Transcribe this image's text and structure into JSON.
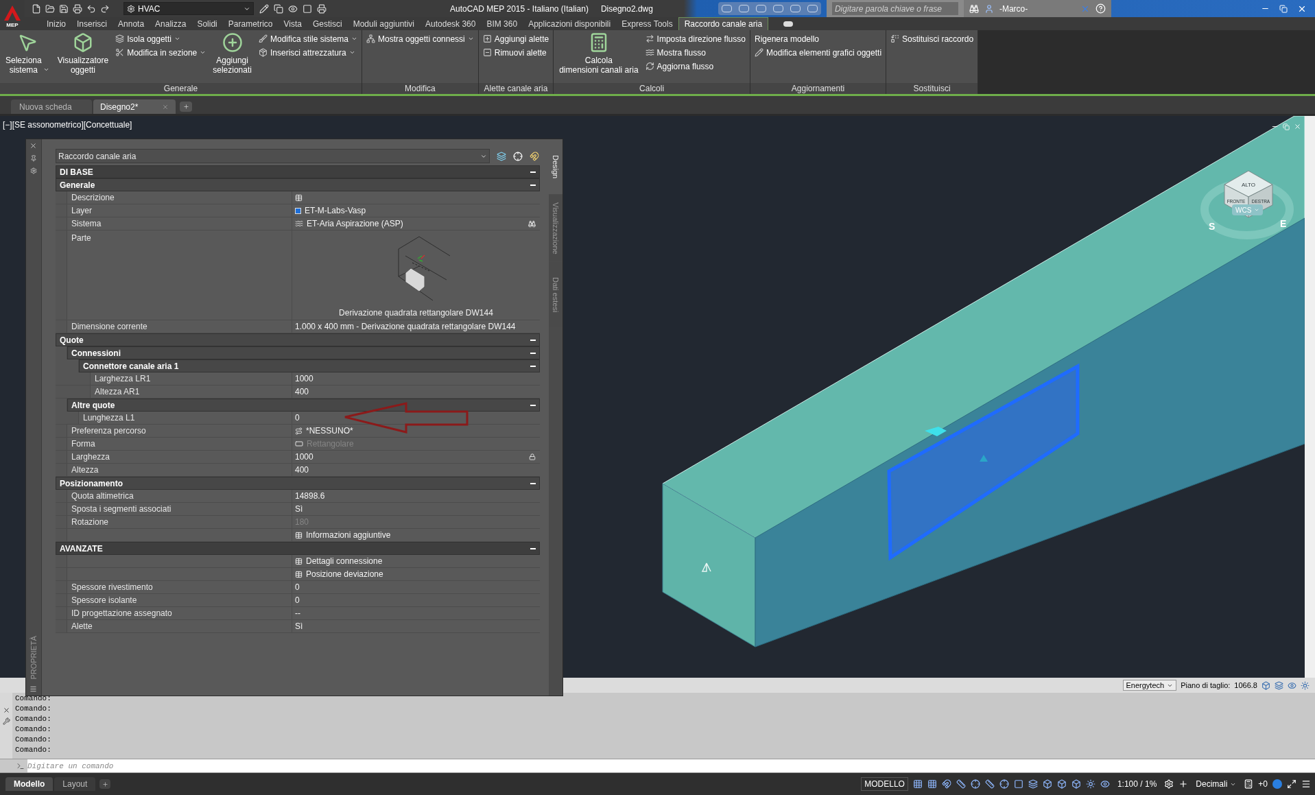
{
  "title_bar": {
    "app_label": "MEP",
    "workspace": "HVAC",
    "title": "AutoCAD MEP 2015 - Italiano (Italian)",
    "file": "Disegno2.dwg",
    "search": {
      "placeholder": "Digitare parola chiave o frase"
    },
    "user": "-Marco-"
  },
  "ribbon": {
    "tabs": [
      {
        "label": "Inizio",
        "selected": false
      },
      {
        "label": "Inserisci",
        "selected": false
      },
      {
        "label": "Annota",
        "selected": false
      },
      {
        "label": "Analizza",
        "selected": false
      },
      {
        "label": "Solidi",
        "selected": false
      },
      {
        "label": "Parametrico",
        "selected": false
      },
      {
        "label": "Vista",
        "selected": false
      },
      {
        "label": "Gestisci",
        "selected": false
      },
      {
        "label": "Moduli aggiuntivi",
        "selected": false
      },
      {
        "label": "Autodesk 360",
        "selected": false
      },
      {
        "label": "BIM 360",
        "selected": false
      },
      {
        "label": "Applicazioni disponibili",
        "selected": false
      },
      {
        "label": "Express Tools",
        "selected": false
      },
      {
        "label": "Raccordo canale aria",
        "selected": true
      }
    ],
    "panels": [
      {
        "title": "Generale",
        "items": [
          {
            "kind": "large",
            "label": "Seleziona\nsistema",
            "dropdown": true
          },
          {
            "kind": "large",
            "label": "Visualizzatore\noggetti",
            "dropdown": false
          },
          {
            "kind": "stack",
            "items": [
              {
                "label": "Isola oggetti",
                "dropdown": true
              },
              {
                "label": "Modifica in sezione",
                "dropdown": true
              }
            ]
          },
          {
            "kind": "large",
            "label": "Aggiungi\nselezionati",
            "dropdown": false
          },
          {
            "kind": "stack",
            "items": [
              {
                "label": "Modifica stile sistema",
                "dropdown": true
              },
              {
                "label": "Inserisci attrezzatura",
                "dropdown": true
              }
            ]
          }
        ]
      },
      {
        "title": "Modifica",
        "items": [
          {
            "kind": "stack",
            "items": [
              {
                "label": "Mostra oggetti connessi",
                "dropdown": true
              }
            ]
          }
        ]
      },
      {
        "title": "Alette canale aria",
        "items": [
          {
            "kind": "stack",
            "items": [
              {
                "label": "Aggiungi alette",
                "dropdown": false
              },
              {
                "label": "Rimuovi alette",
                "dropdown": false
              }
            ]
          }
        ]
      },
      {
        "title": "Calcoli",
        "items": [
          {
            "kind": "large",
            "label": "Calcola\ndimensioni canali aria",
            "dropdown": false
          },
          {
            "kind": "stack",
            "items": [
              {
                "label": "Imposta direzione flusso",
                "dropdown": false
              },
              {
                "label": "Mostra flusso",
                "dropdown": false
              },
              {
                "label": "Aggiorna flusso",
                "dropdown": false
              }
            ]
          }
        ]
      },
      {
        "title": "Aggiornamenti",
        "items": [
          {
            "kind": "stack",
            "items": [
              {
                "label": "Rigenera modello",
                "dropdown": false,
                "plain": true
              },
              {
                "label": "Modifica elementi grafici oggetti",
                "dropdown": false,
                "plain": false
              }
            ]
          }
        ]
      },
      {
        "title": "Sostituisci",
        "items": [
          {
            "kind": "stack",
            "items": [
              {
                "label": "Sostituisci raccordo",
                "dropdown": false
              }
            ]
          }
        ]
      }
    ]
  },
  "document_tabs": [
    {
      "label": "Nuova scheda",
      "selected": false
    },
    {
      "label": "Disegno2*",
      "selected": true
    }
  ],
  "viewport": {
    "label": "[−][SE assonometrico][Concettuale]",
    "view_cube": {
      "top": "ALTO",
      "front": "FRONTE",
      "right": "DESTRA",
      "compass": [
        "S",
        "E"
      ]
    },
    "ucs": "WCS"
  },
  "properties": {
    "title": "PROPRIETÀ",
    "object_type": "Raccordo canale aria",
    "tabs": [
      {
        "label": "Design",
        "selected": true
      },
      {
        "label": "Visualizzazione",
        "selected": false
      },
      {
        "label": "Dati estesi",
        "selected": false
      }
    ],
    "groups": [
      {
        "kind": "group",
        "label": "DI BASE",
        "expanded": true,
        "children": [
          {
            "kind": "category",
            "label": "Generale",
            "expanded": true,
            "children": [
              {
                "kind": "link",
                "label": "Descrizione",
                "disabled": false
              },
              {
                "kind": "layer",
                "label": "Layer",
                "value": "ET-M-Labs-Vasp",
                "color": "#1e6fd9",
                "disabled": false
              },
              {
                "kind": "system",
                "label": "Sistema",
                "value": "ET-Aria Aspirazione (ASP)",
                "disabled": false
              },
              {
                "kind": "preview",
                "label": "Parte",
                "caption": "Derivazione quadrata rettangolare DW144"
              },
              {
                "kind": "property",
                "label": "Dimensione corrente",
                "value": "1.000 x 400 mm - Derivazione quadrata rettangolare DW144",
                "disabled": false
              }
            ]
          },
          {
            "kind": "category",
            "label": "Quote",
            "expanded": true,
            "children": [
              {
                "kind": "category",
                "label": "Connessioni",
                "expanded": true,
                "children": [
                  {
                    "kind": "category",
                    "label": "Connettore canale aria 1",
                    "expanded": true,
                    "children": [
                      {
                        "kind": "property",
                        "label": "Larghezza LR1",
                        "value": "1000",
                        "disabled": false
                      },
                      {
                        "kind": "property",
                        "label": "Altezza AR1",
                        "value": "400",
                        "disabled": false
                      }
                    ]
                  }
                ]
              },
              {
                "kind": "category",
                "label": "Altre quote",
                "expanded": true,
                "children": [
                  {
                    "kind": "property",
                    "label": "Lunghezza L1",
                    "value": "0",
                    "disabled": false,
                    "annotated": true
                  }
                ]
              },
              {
                "kind": "route",
                "label": "Preferenza percorso",
                "value": "*NESSUNO*",
                "disabled": false
              },
              {
                "kind": "shape",
                "label": "Forma",
                "value": "Rettangolare",
                "disabled": true
              },
              {
                "kind": "locked",
                "label": "Larghezza",
                "value": "1000",
                "disabled": false
              },
              {
                "kind": "property",
                "label": "Altezza",
                "value": "400",
                "disabled": false
              }
            ]
          },
          {
            "kind": "category",
            "label": "Posizionamento",
            "expanded": true,
            "children": [
              {
                "kind": "property",
                "label": "Quota altimetrica",
                "value": "14898.6",
                "disabled": false
              },
              {
                "kind": "property",
                "label": "Sposta i segmenti associati",
                "value": "Sì",
                "disabled": false
              },
              {
                "kind": "property",
                "label": "Rotazione",
                "value": "180",
                "disabled": true
              },
              {
                "kind": "link",
                "value": "Informazioni aggiuntive",
                "disabled": false
              }
            ]
          }
        ]
      },
      {
        "kind": "group",
        "label": "AVANZATE",
        "expanded": true,
        "children": [
          {
            "kind": "link",
            "value": "Dettagli connessione",
            "disabled": false
          },
          {
            "kind": "link",
            "value": "Posizione deviazione",
            "disabled": false
          },
          {
            "kind": "property",
            "label": "Spessore rivestimento",
            "value": "0",
            "disabled": false
          },
          {
            "kind": "property",
            "label": "Spessore isolante",
            "value": "0",
            "disabled": false
          },
          {
            "kind": "property",
            "label": "ID progettazione assegnato",
            "value": "--",
            "disabled": false
          },
          {
            "kind": "property",
            "label": "Alette",
            "value": "Sì",
            "disabled": false
          }
        ]
      }
    ]
  },
  "viewport_status": {
    "style": "Energytech",
    "cut_plane_label": "Piano di taglio:",
    "cut_plane_value": "1066.8"
  },
  "command_line": {
    "history": [
      "Comando:",
      "Comando:",
      "Comando:",
      "Comando:",
      "Comando:",
      "Comando:"
    ],
    "placeholder": "Digitare un comando"
  },
  "status_bar": {
    "layout_tabs": [
      {
        "label": "Modello",
        "selected": true
      },
      {
        "label": "Layout",
        "selected": false
      }
    ],
    "space": "MODELLO",
    "scale": "1:100 / 1%",
    "units": "Decimali",
    "transparency": "+0"
  }
}
